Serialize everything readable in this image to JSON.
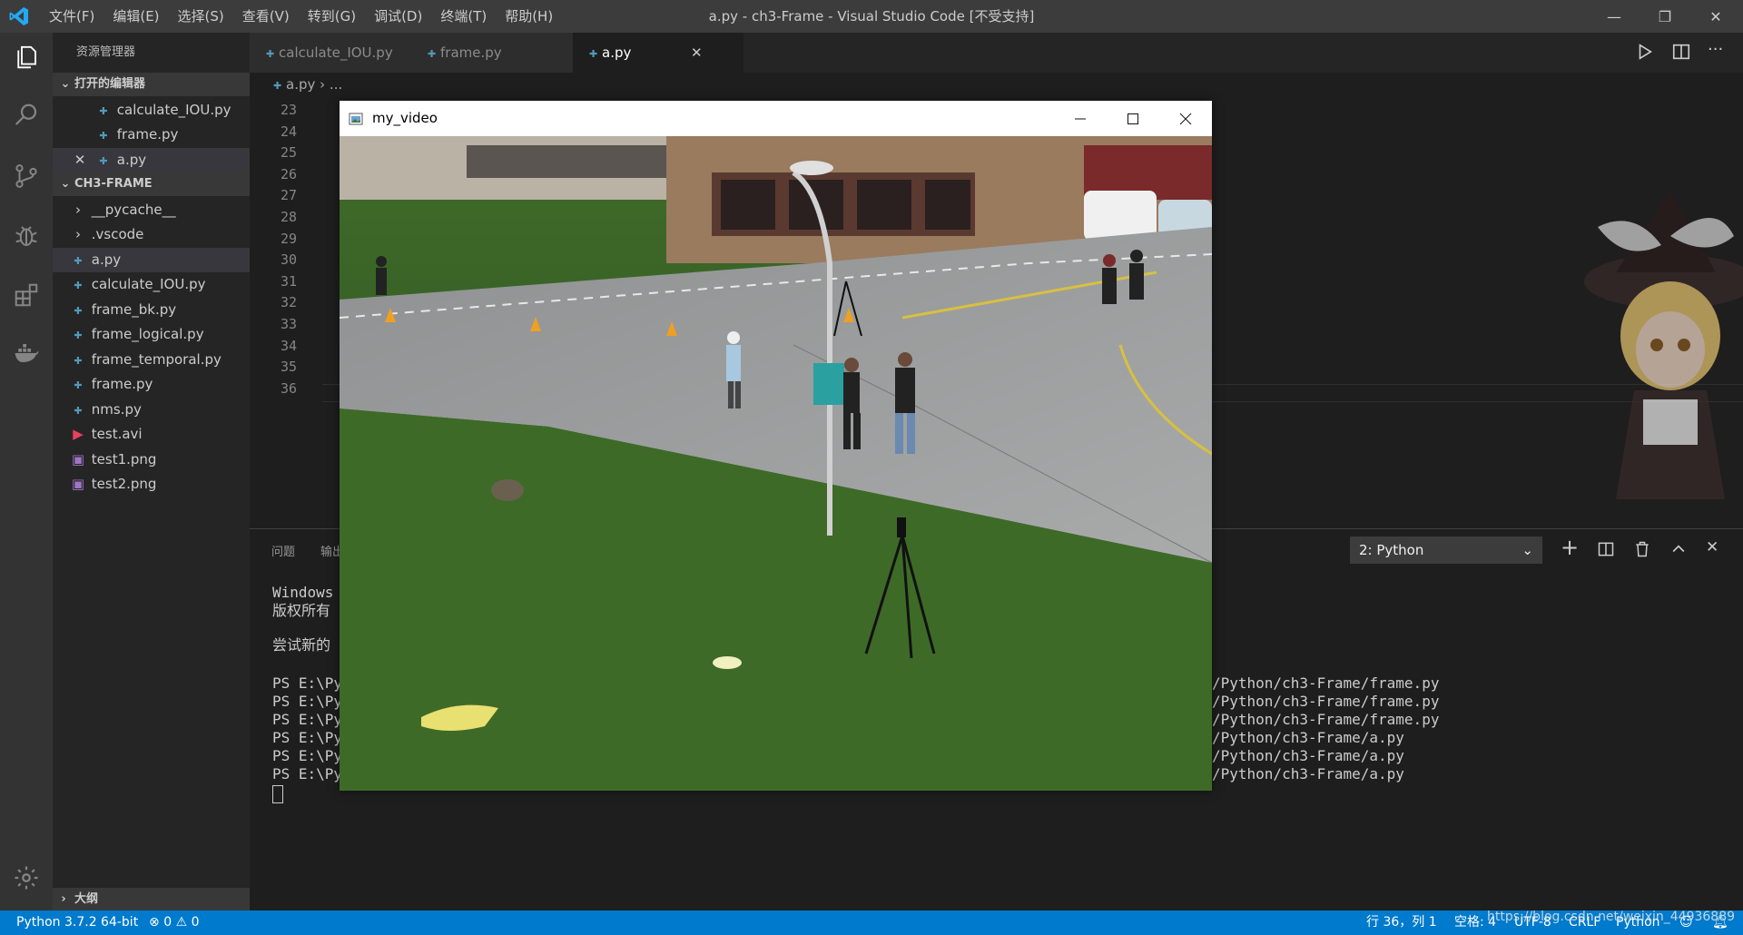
{
  "window": {
    "title": "a.py - ch3-Frame - Visual Studio Code [不受支持]",
    "minimize": "—",
    "restore": "❐",
    "close": "✕"
  },
  "menu": [
    "文件(F)",
    "编辑(E)",
    "选择(S)",
    "查看(V)",
    "转到(G)",
    "调试(D)",
    "终端(T)",
    "帮助(H)"
  ],
  "sidebar": {
    "title": "资源管理器",
    "open_editors_header": "打开的编辑器",
    "open_editors": [
      "calculate_IOU.py",
      "frame.py",
      "a.py"
    ],
    "folder_header": "CH3-FRAME",
    "folders": [
      "__pycache__",
      ".vscode"
    ],
    "files": [
      "a.py",
      "calculate_IOU.py",
      "frame_bk.py",
      "frame_logical.py",
      "frame_temporal.py",
      "frame.py",
      "nms.py",
      "test.avi",
      "test1.png",
      "test2.png"
    ],
    "outline_header": "大纲"
  },
  "tabs": [
    "calculate_IOU.py",
    "frame.py",
    "a.py"
  ],
  "breadcrumb": {
    "file": "a.py",
    "rest": "..."
  },
  "editor": {
    "line_numbers": [
      "23",
      "24",
      "25",
      "26",
      "27",
      "28",
      "29",
      "30",
      "31",
      "32",
      "33",
      "34",
      "35",
      "36"
    ]
  },
  "panel": {
    "tabs": [
      "问题",
      "输出"
    ],
    "terminal_select": "2: Python",
    "lines_left": [
      "Windows",
      "版权所有",
      "",
      "尝试新的",
      "",
      "PS E:\\Py",
      "PS E:\\Py",
      "PS E:\\Py",
      "PS E:\\Py",
      "PS E:\\Py",
      "PS E:\\Py"
    ],
    "lines_right": [
      "/Python/ch3-Frame/frame.py",
      "/Python/ch3-Frame/frame.py",
      "/Python/ch3-Frame/frame.py",
      "/Python/ch3-Frame/a.py",
      "/Python/ch3-Frame/a.py",
      "/Python/ch3-Frame/a.py"
    ]
  },
  "video": {
    "title": "my_video"
  },
  "statusbar": {
    "python": "Python 3.7.2 64-bit",
    "errors": "0",
    "warnings": "0",
    "position": "行 36，列 1",
    "spaces": "空格: 4",
    "encoding": "UTF-8",
    "eol": "CRLF",
    "language": "Python"
  },
  "watermark": "https://blog.csdn.net/weixin_44936889",
  "colors": {
    "accent": "#007acc",
    "python_icon": "#519aba",
    "avi_icon": "#e8405f",
    "png_icon": "#a074c4"
  }
}
